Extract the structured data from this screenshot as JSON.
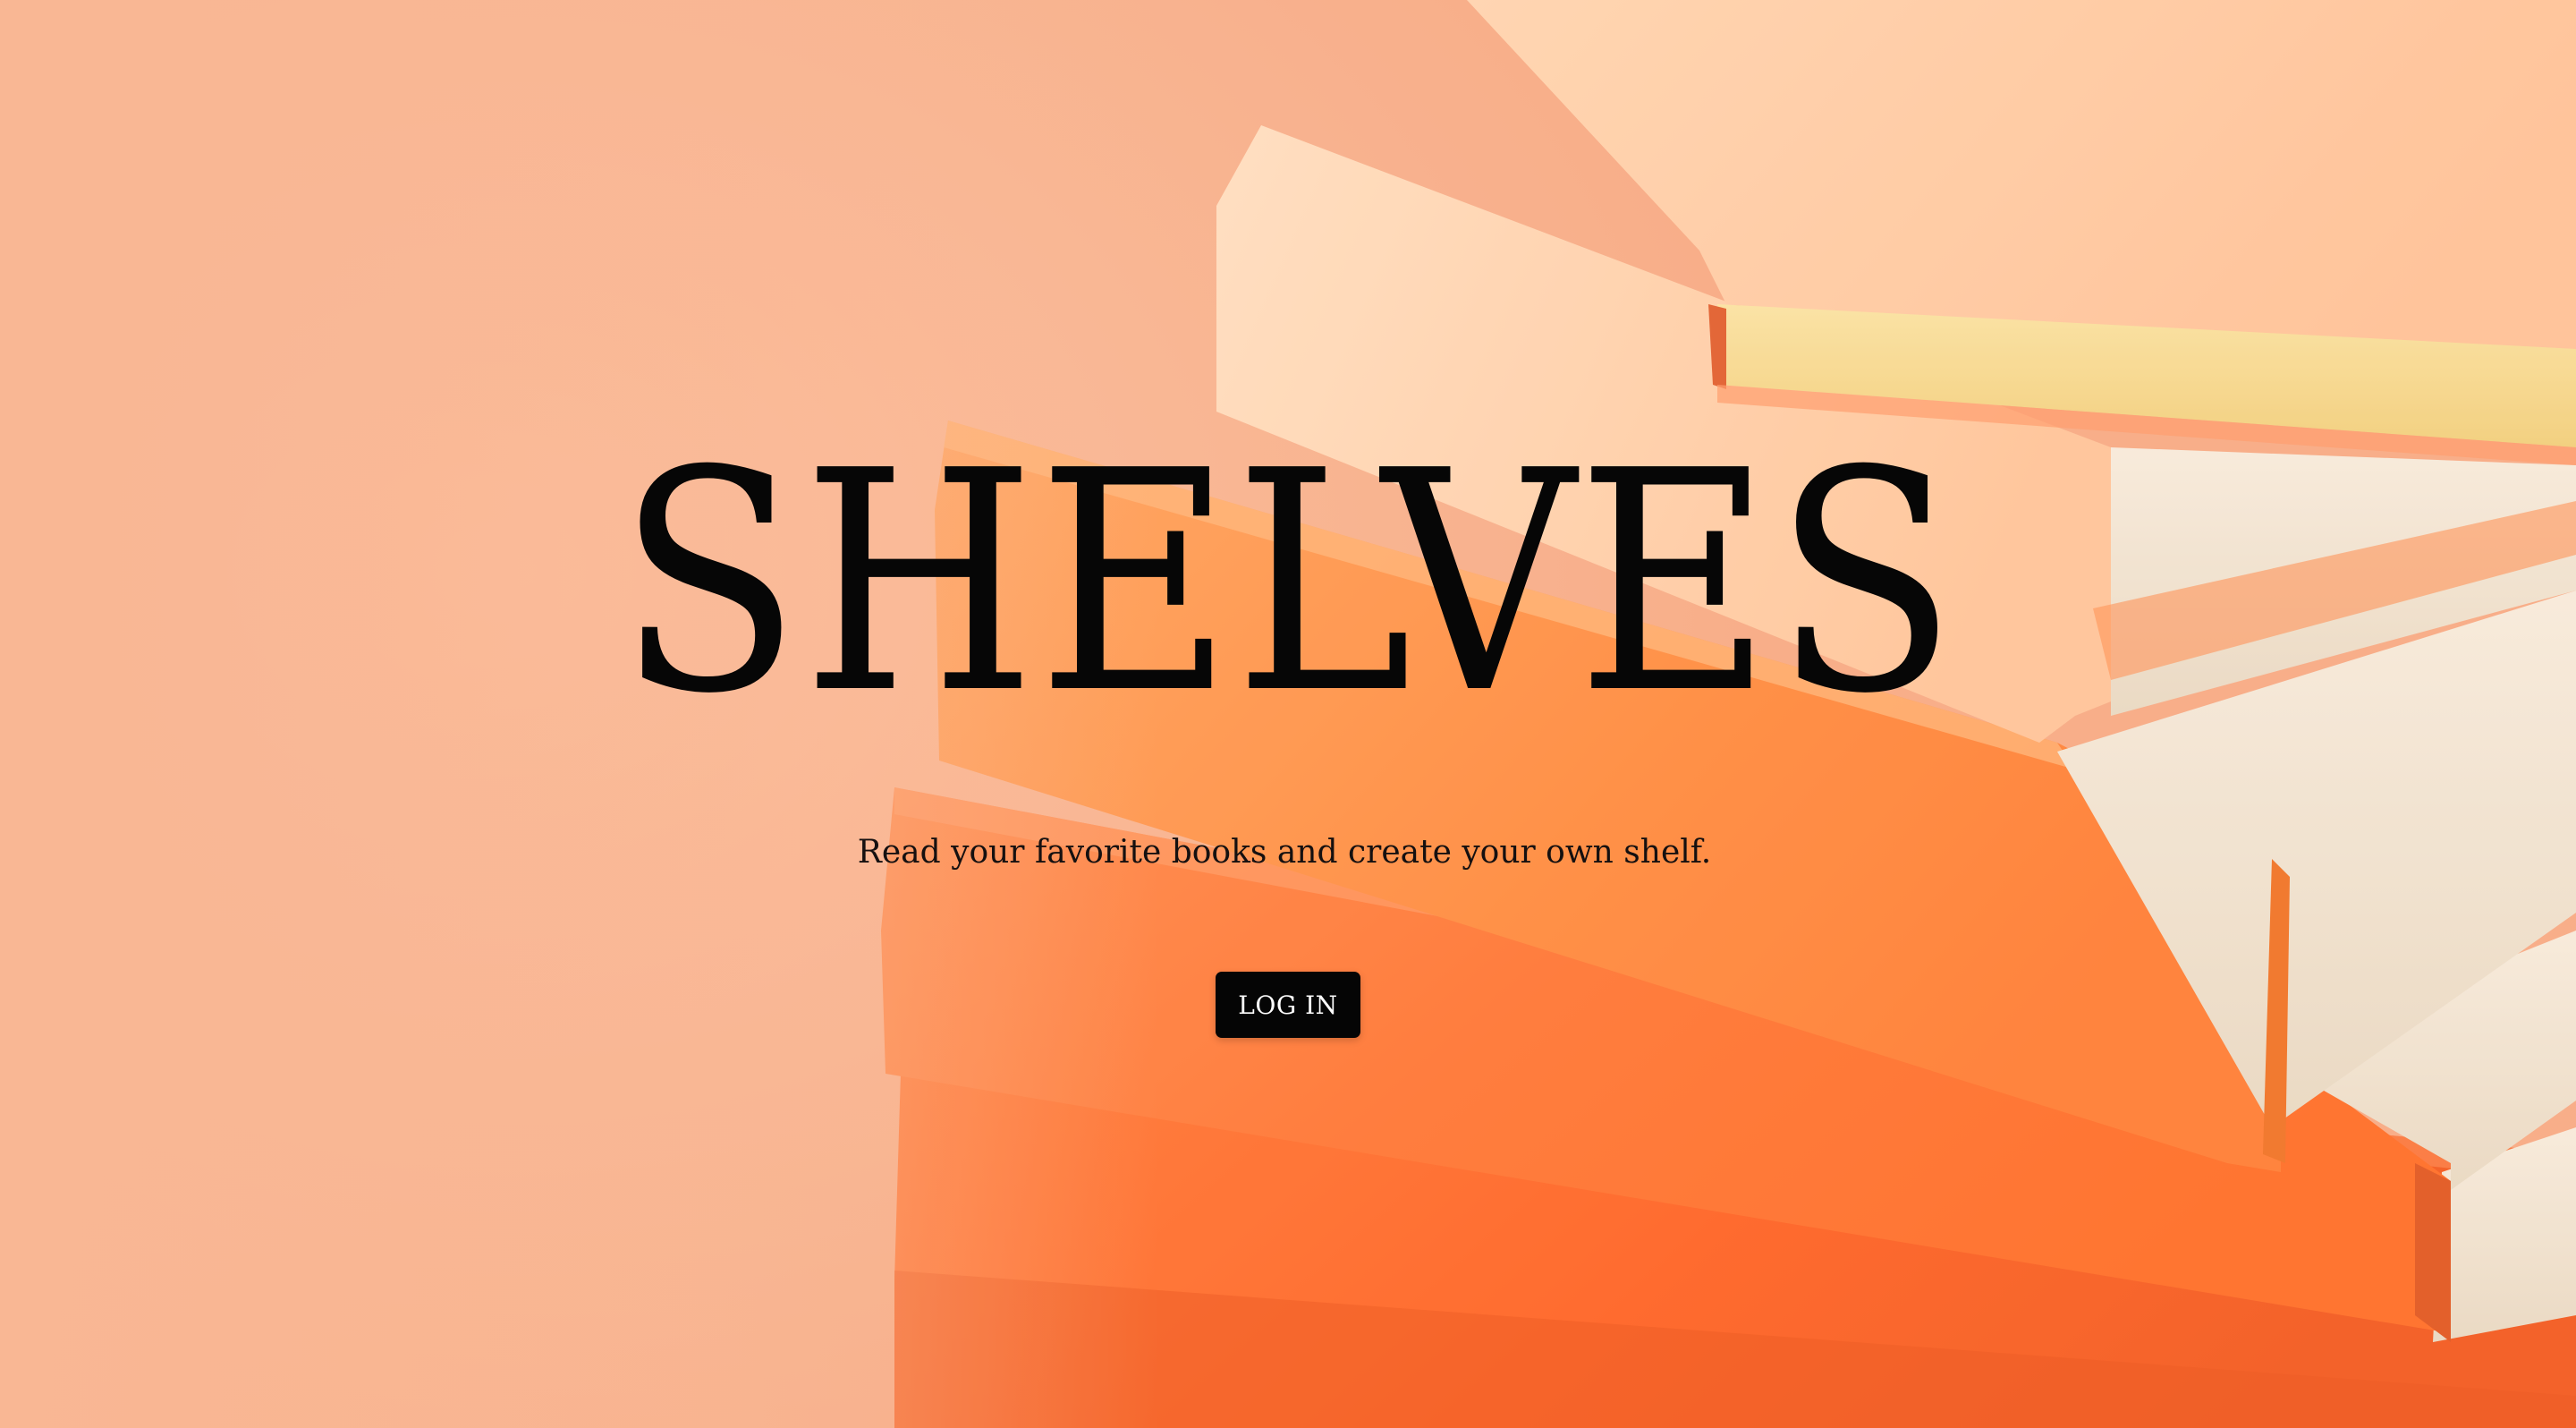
{
  "hero": {
    "title": "SHELVES",
    "tagline": "Read your favorite books and create your own shelf.",
    "login_label": "LOG IN",
    "background_image": "stack-of-orange-books-photo"
  },
  "colors": {
    "background_peach": "#f9b896",
    "book_orange": "#ff6a2a",
    "book_light": "#ffcfad",
    "text": "#060606",
    "button_bg": "#050505",
    "button_text": "#ffffff"
  }
}
